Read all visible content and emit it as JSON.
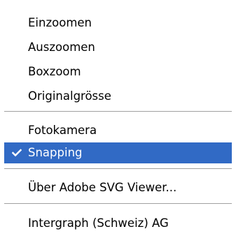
{
  "context_menu": {
    "items": [
      {
        "label": "Einzoomen",
        "checked": false,
        "highlighted": false
      },
      {
        "label": "Auszoomen",
        "checked": false,
        "highlighted": false
      },
      {
        "label": "Boxzoom",
        "checked": false,
        "highlighted": false
      },
      {
        "label": "Originalgrösse",
        "checked": false,
        "highlighted": false
      },
      {
        "label": "Fotokamera",
        "checked": false,
        "highlighted": false
      },
      {
        "label": "Snapping",
        "checked": true,
        "highlighted": true
      },
      {
        "label": "Über Adobe SVG Viewer...",
        "checked": false,
        "highlighted": false
      },
      {
        "label": "Intergraph (Schweiz) AG",
        "checked": false,
        "highlighted": false
      }
    ],
    "check_icon": "checkmark-icon",
    "colors": {
      "highlight_background": "#316ac5",
      "highlight_text": "#ffffff",
      "text": "#000000",
      "separator": "#a0a0a0"
    }
  }
}
